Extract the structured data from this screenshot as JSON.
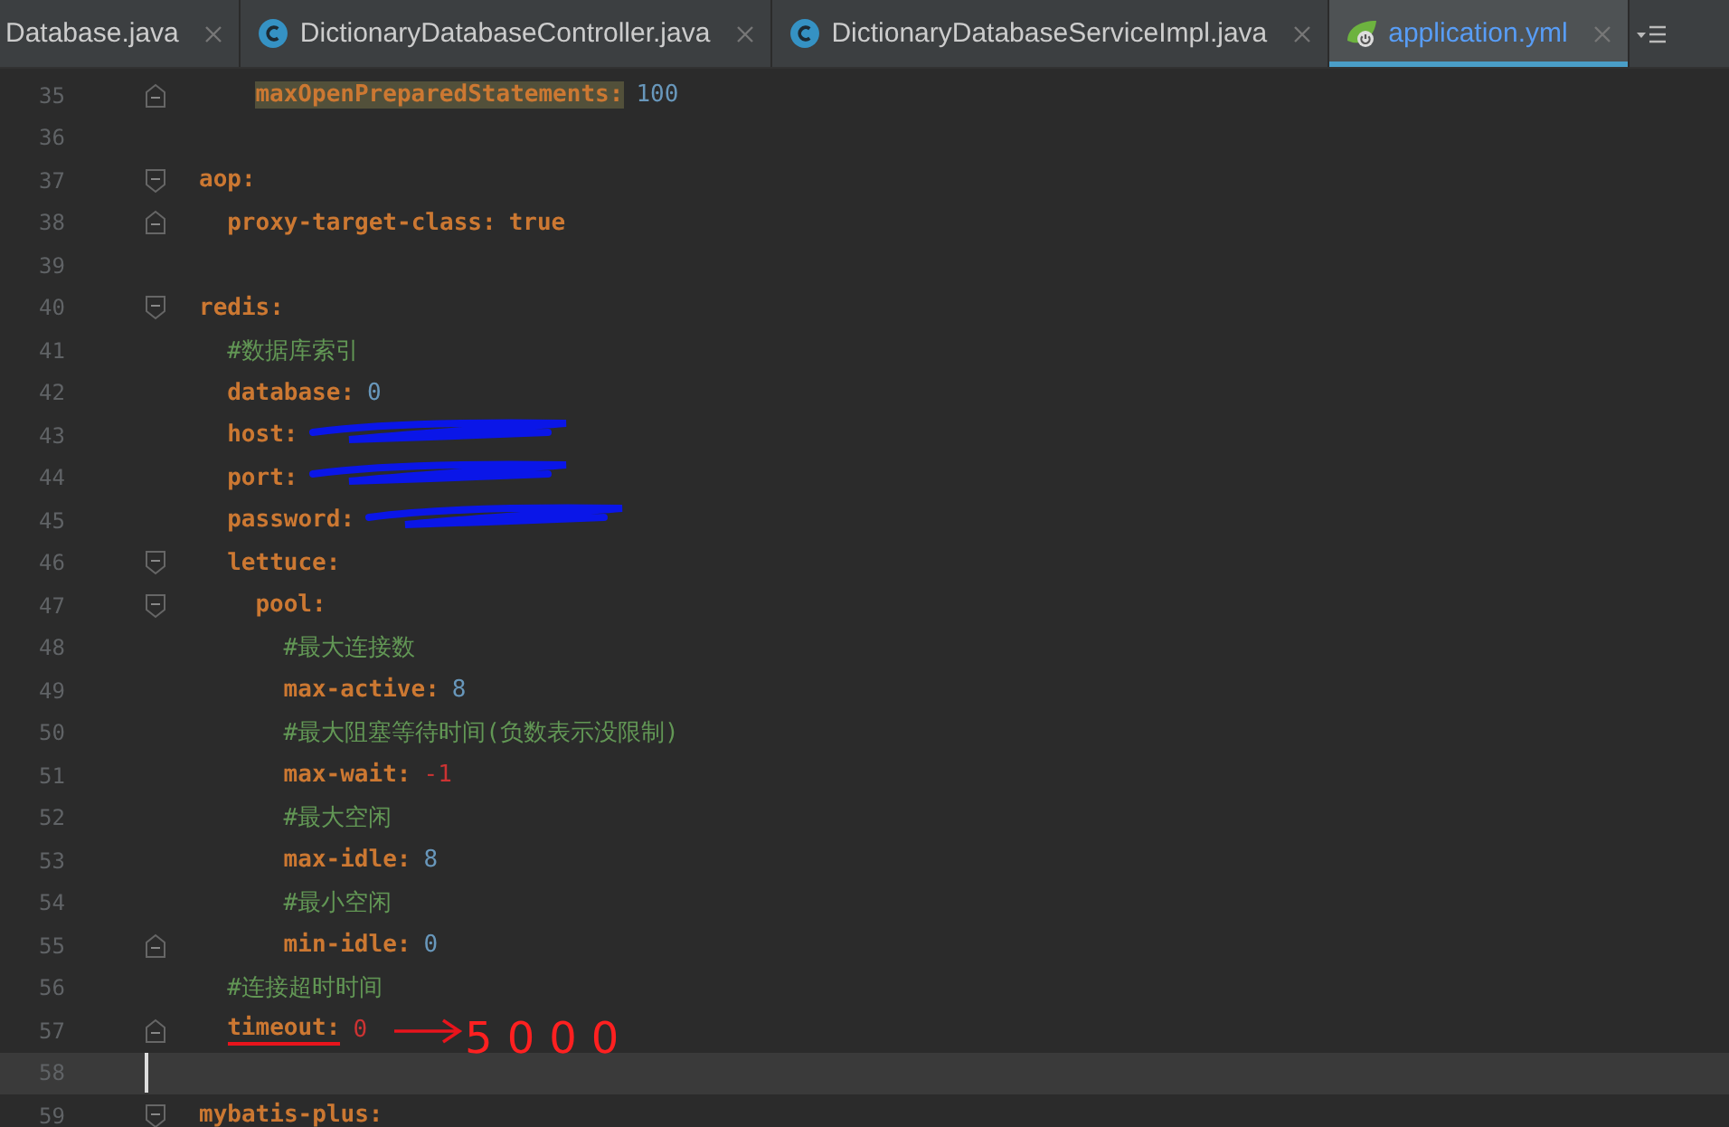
{
  "tabs": [
    {
      "label": "Database.java",
      "kind": "plain",
      "selected": false
    },
    {
      "label": "DictionaryDatabaseController.java",
      "kind": "class",
      "selected": false
    },
    {
      "label": "DictionaryDatabaseServiceImpl.java",
      "kind": "class",
      "selected": false
    },
    {
      "label": "application.yml",
      "kind": "spring",
      "selected": true
    }
  ],
  "lines": [
    {
      "children": [
        {
          "children": [
            {
              "number": "35",
              "kind": "number",
              "key": "maxOpenPreparedStatements:",
              "highlighted": true,
              "value": "100",
              "current": false
            }
          ]
        }
      ]
    },
    {
      "number": "36",
      "current": false
    },
    {
      "number": "37",
      "kind": "section",
      "key": "aop:",
      "current": false,
      "children": [
        {
          "number": "38",
          "kind": "boolean",
          "key": "proxy-target-class:",
          "value": "true",
          "current": false
        }
      ]
    },
    {
      "number": "39",
      "current": false
    },
    {
      "number": "40",
      "kind": "section",
      "key": "redis:",
      "current": false,
      "children": [
        {
          "number": "41",
          "kind": "comment",
          "comment": "#数据库索引",
          "current": false
        },
        {
          "number": "42",
          "kind": "number",
          "key": "database:",
          "value": "0",
          "current": false
        },
        {
          "number": "43",
          "kind": "redacted",
          "key": "host:",
          "current": false
        },
        {
          "number": "44",
          "kind": "redacted",
          "key": "port:",
          "current": false
        },
        {
          "number": "45",
          "kind": "redacted",
          "key": "password:",
          "current": false
        },
        {
          "number": "46",
          "kind": "section",
          "key": "lettuce:",
          "current": false,
          "children": [
            {
              "number": "47",
              "kind": "section",
              "key": "pool:",
              "current": false,
              "children": [
                {
                  "number": "48",
                  "kind": "comment",
                  "comment": "#最大连接数",
                  "current": false
                },
                {
                  "number": "49",
                  "kind": "number",
                  "key": "max-active:",
                  "value": "8",
                  "current": false
                },
                {
                  "number": "50",
                  "kind": "comment",
                  "comment": "#最大阻塞等待时间(负数表示没限制)",
                  "current": false
                },
                {
                  "number": "51",
                  "kind": "error",
                  "key": "max-wait:",
                  "value": "-1",
                  "current": false
                },
                {
                  "number": "52",
                  "kind": "comment",
                  "comment": "#最大空闲",
                  "current": false
                },
                {
                  "number": "53",
                  "kind": "number",
                  "key": "max-idle:",
                  "value": "8",
                  "current": false
                },
                {
                  "number": "54",
                  "kind": "comment",
                  "comment": "#最小空闲",
                  "current": false
                },
                {
                  "number": "55",
                  "kind": "number",
                  "key": "min-idle:",
                  "value": "0",
                  "current": false
                }
              ]
            }
          ]
        },
        {
          "number": "56",
          "kind": "comment",
          "comment": "#连接超时时间",
          "current": false
        },
        {
          "number": "57",
          "kind": "error",
          "key": "timeout:",
          "value": "0",
          "underlined": true,
          "annotation": "5000",
          "current": false
        }
      ]
    },
    {
      "number": "58",
      "current": true
    },
    {
      "number": "59",
      "kind": "section",
      "key": "mybatis-plus:",
      "foldable": true,
      "current": false
    }
  ]
}
